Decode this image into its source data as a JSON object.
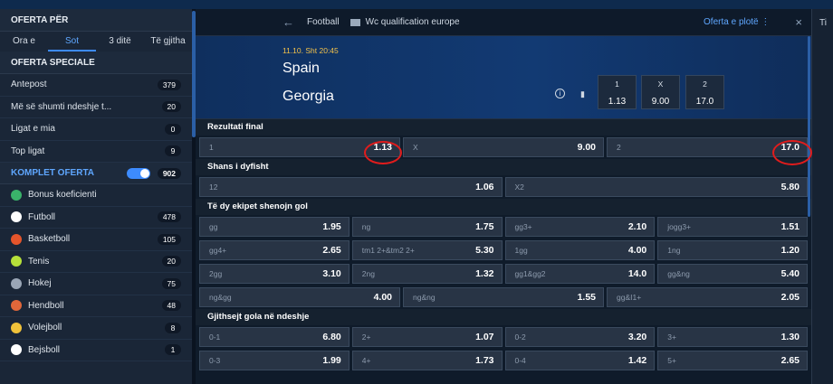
{
  "sidebar": {
    "oferta_title": "OFERTA PËR",
    "tabs": [
      {
        "label": "Ora e"
      },
      {
        "label": "Sot"
      },
      {
        "label": "3 ditë"
      },
      {
        "label": "Të gjitha"
      }
    ],
    "special_title": "OFERTA SPECIALE",
    "special_items": [
      {
        "label": "Antepost",
        "count": "379"
      },
      {
        "label": "Më së shumti ndeshje t...",
        "count": "20"
      },
      {
        "label": "Ligat e mia",
        "count": "0"
      },
      {
        "label": "Top ligat",
        "count": "9"
      }
    ],
    "komplet_label": "KOMPLET OFERTA",
    "komplet_count": "902",
    "sports": [
      {
        "label": "Bonus koeficienti",
        "count": "",
        "color": "#3ab36a"
      },
      {
        "label": "Futboll",
        "count": "478",
        "color": "#ffffff"
      },
      {
        "label": "Basketboll",
        "count": "105",
        "color": "#e5552b"
      },
      {
        "label": "Tenis",
        "count": "20",
        "color": "#b6e03a"
      },
      {
        "label": "Hokej",
        "count": "75",
        "color": "#9aa6b6"
      },
      {
        "label": "Hendboll",
        "count": "48",
        "color": "#e0673a"
      },
      {
        "label": "Volejboll",
        "count": "8",
        "color": "#f0c23a"
      },
      {
        "label": "Bejsboll",
        "count": "1",
        "color": "#ffffff"
      }
    ]
  },
  "header": {
    "sport": "Football",
    "league": "Wc qualification europe",
    "full_offer": "Oferta e plotë ⋮",
    "right_tab": "Ti"
  },
  "match": {
    "time": "11.10. Sht 20:45",
    "home": "Spain",
    "away": "Georgia",
    "odds": [
      {
        "k": "1",
        "v": "1.13"
      },
      {
        "k": "X",
        "v": "9.00"
      },
      {
        "k": "2",
        "v": "17.0"
      }
    ]
  },
  "markets": [
    {
      "title": "Rezultati final",
      "rows": [
        [
          {
            "k": "1",
            "v": "1.13"
          },
          {
            "k": "X",
            "v": "9.00"
          },
          {
            "k": "2",
            "v": "17.0"
          }
        ]
      ]
    },
    {
      "title": "Shans i dyfisht",
      "rows": [
        [
          {
            "k": "12",
            "v": "1.06"
          },
          {
            "k": "X2",
            "v": "5.80"
          }
        ]
      ]
    },
    {
      "title": "Të dy ekipet shenojn gol",
      "rows": [
        [
          {
            "k": "gg",
            "v": "1.95"
          },
          {
            "k": "ng",
            "v": "1.75"
          },
          {
            "k": "gg3+",
            "v": "2.10"
          },
          {
            "k": "jogg3+",
            "v": "1.51"
          }
        ],
        [
          {
            "k": "gg4+",
            "v": "2.65"
          },
          {
            "k": "tm1 2+&tm2 2+",
            "v": "5.30"
          },
          {
            "k": "1gg",
            "v": "4.00"
          },
          {
            "k": "1ng",
            "v": "1.20"
          }
        ],
        [
          {
            "k": "2gg",
            "v": "3.10"
          },
          {
            "k": "2ng",
            "v": "1.32"
          },
          {
            "k": "gg1&gg2",
            "v": "14.0"
          },
          {
            "k": "gg&ng",
            "v": "5.40"
          }
        ],
        [
          {
            "k": "ng&gg",
            "v": "4.00"
          },
          {
            "k": "ng&ng",
            "v": "1.55"
          },
          {
            "k": "gg&I1+",
            "v": "2.05"
          }
        ]
      ]
    },
    {
      "title": "Gjithsejt gola në ndeshje",
      "rows": [
        [
          {
            "k": "0-1",
            "v": "6.80"
          },
          {
            "k": "2+",
            "v": "1.07"
          },
          {
            "k": "0-2",
            "v": "3.20"
          },
          {
            "k": "3+",
            "v": "1.30"
          }
        ],
        [
          {
            "k": "0-3",
            "v": "1.99"
          },
          {
            "k": "4+",
            "v": "1.73"
          },
          {
            "k": "0-4",
            "v": "1.42"
          },
          {
            "k": "5+",
            "v": "2.65"
          }
        ]
      ]
    }
  ],
  "colors": {
    "accent": "#3d8bfd",
    "highlight_ring": "#e11c1c",
    "time": "#f3c24a"
  }
}
